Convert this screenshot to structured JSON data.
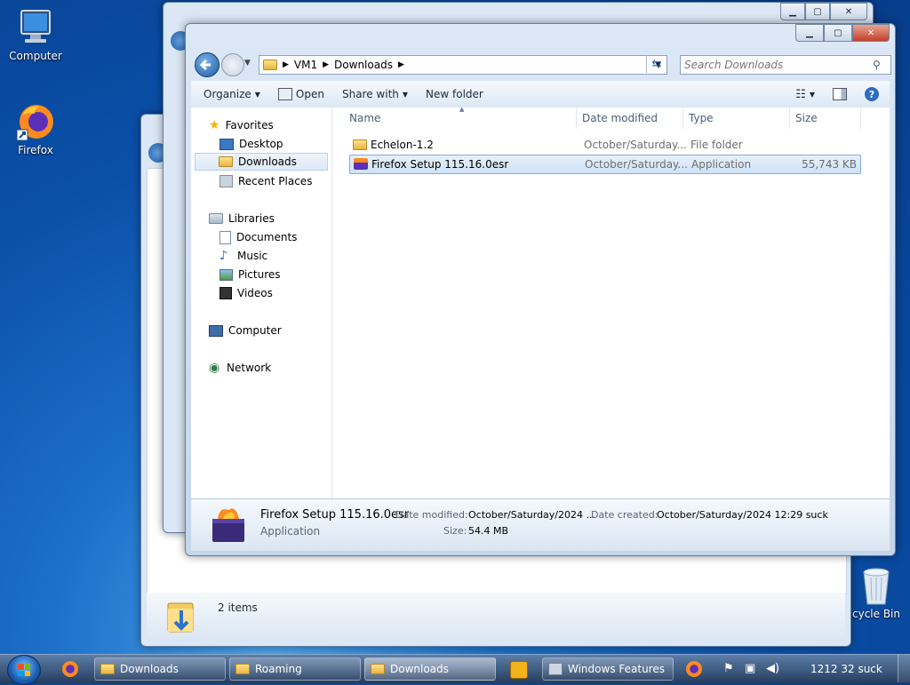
{
  "desktop": {
    "icons": [
      {
        "label": "Computer",
        "icon": "computer-icon"
      },
      {
        "label": "Firefox",
        "icon": "firefox-icon"
      },
      {
        "label": "cycle Bin",
        "icon": "recycle-bin-icon"
      }
    ]
  },
  "back_window": {
    "status_text": "2 items"
  },
  "window": {
    "breadcrumb": [
      "VM1",
      "Downloads"
    ],
    "search_placeholder": "Search Downloads",
    "toolbar": {
      "organize": "Organize",
      "open": "Open",
      "share_with": "Share with",
      "new_folder": "New folder"
    },
    "nav": {
      "favorites": "Favorites",
      "desktop": "Desktop",
      "downloads": "Downloads",
      "recent_places": "Recent Places",
      "libraries": "Libraries",
      "documents": "Documents",
      "music": "Music",
      "pictures": "Pictures",
      "videos": "Videos",
      "computer": "Computer",
      "network": "Network"
    },
    "columns": {
      "name": "Name",
      "date_modified": "Date modified",
      "type": "Type",
      "size": "Size"
    },
    "files": [
      {
        "name": "Echelon-1.2",
        "date": "October/Saturday...",
        "type": "File folder",
        "size": ""
      },
      {
        "name": "Firefox Setup 115.16.0esr",
        "date": "October/Saturday...",
        "type": "Application",
        "size": "55,743 KB"
      }
    ],
    "details": {
      "title": "Firefox Setup 115.16.0esr",
      "type": "Application",
      "date_modified_label": "Date modified:",
      "date_modified_value": "October/Saturday/2024 ...",
      "date_created_label": "Date created:",
      "date_created_value": "October/Saturday/2024 12:29 suck",
      "size_label": "Size:",
      "size_value": "54.4 MB"
    }
  },
  "taskbar": {
    "buttons": [
      {
        "label": "Downloads"
      },
      {
        "label": "Roaming"
      },
      {
        "label": "Downloads"
      },
      {
        "label": "Windows Features"
      }
    ],
    "clock": "1212 32 suck"
  }
}
